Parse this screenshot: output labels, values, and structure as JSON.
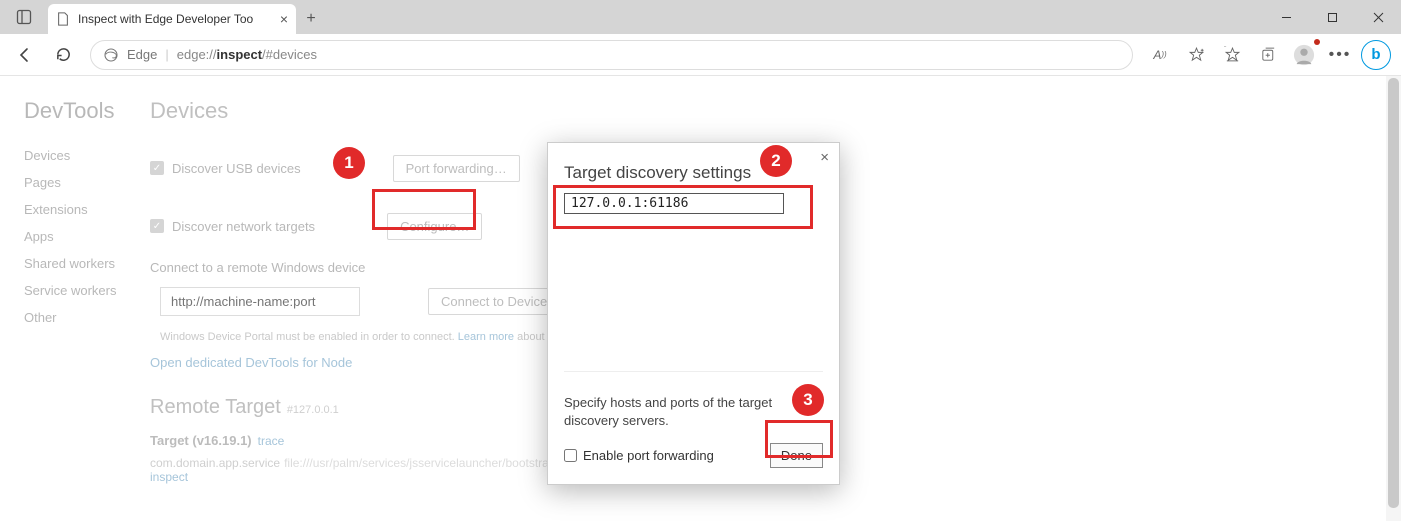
{
  "titlebar": {
    "tab_title": "Inspect with Edge Developer Too",
    "min": "—",
    "max": "▢",
    "close": "✕"
  },
  "toolbar": {
    "edge_label": "Edge",
    "url_prefix": "edge://",
    "url_bold": "inspect",
    "url_rest": "/#devices"
  },
  "sidebar": {
    "title": "DevTools",
    "items": [
      "Devices",
      "Pages",
      "Extensions",
      "Apps",
      "Shared workers",
      "Service workers",
      "Other"
    ]
  },
  "main": {
    "heading": "Devices",
    "row1": {
      "label": "Discover USB devices",
      "button": "Port forwarding…"
    },
    "row2": {
      "label": "Discover network targets",
      "button": "Configure…"
    },
    "connect_label": "Connect to a remote Windows device",
    "remote_placeholder": "http://machine-name:port",
    "connect_button": "Connect to Device",
    "hint_pre": "Windows Device Portal must be enabled in order to connect. ",
    "hint_link": "Learn more",
    "hint_post": " about ena",
    "open_node": "Open dedicated DevTools for Node",
    "remote_heading": "Remote Target",
    "remote_sub": "#127.0.0.1",
    "target": "Target (v16.19.1)",
    "trace": "trace",
    "svc": "com.domain.app.service",
    "svc_path": "file:///usr/palm/services/jsservicelauncher/bootstrap-node.js",
    "inspect": "inspect"
  },
  "dialog": {
    "title": "Target discovery settings",
    "host_value": "127.0.0.1:61186",
    "foot_text": "Specify hosts and ports of the target discovery servers.",
    "enable_pf": "Enable port forwarding",
    "done": "Done"
  },
  "notes": {
    "n1": "1",
    "n2": "2",
    "n3": "3"
  }
}
